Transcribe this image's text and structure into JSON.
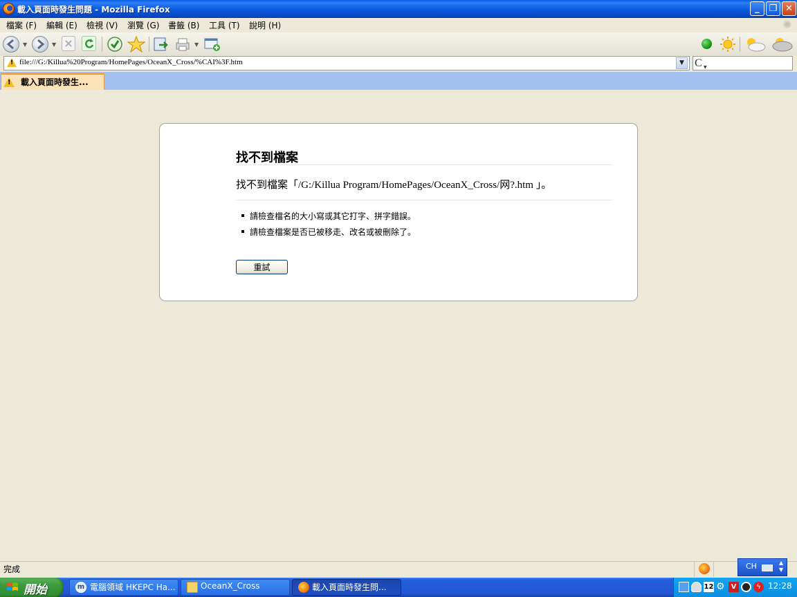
{
  "window": {
    "title": "載入頁面時發生問題 - Mozilla Firefox"
  },
  "menu": {
    "items": [
      "檔案 (F)",
      "編輯 (E)",
      "檢視 (V)",
      "瀏覽 (G)",
      "書籤 (B)",
      "工具 (T)",
      "說明 (H)"
    ]
  },
  "toolbar": {
    "icons": [
      "back-icon",
      "forward-icon",
      "stop-icon",
      "reload-icon",
      "home-icon",
      "bookmark-star-icon",
      "go-icon",
      "print-icon",
      "new-window-icon"
    ]
  },
  "address": {
    "url": "file:///G:/Killua%20Program/HomePages/OceanX_Cross/%CAI%3F.htm",
    "search_engine_icon": "C"
  },
  "tab": {
    "label": "載入頁面時發生..."
  },
  "error": {
    "title": "找不到檔案",
    "message": "找不到檔案「/G:/Killua Program/HomePages/OceanX_Cross/网?.htm 」。",
    "hints": [
      "請檢查檔名的大小寫或其它打字、拼字錯誤。",
      "請檢查檔案是否已被移走、改名或被刪除了。"
    ],
    "retry_label": "重試"
  },
  "status": {
    "text": "完成"
  },
  "language_bar": {
    "label": "CH"
  },
  "taskbar": {
    "start_label": "開始",
    "tasks": [
      {
        "label": "電腦領域 HKEPC Ha..."
      },
      {
        "label": "OceanX_Cross"
      },
      {
        "label": "載入頁面時發生問..."
      }
    ],
    "tray_badge": "12",
    "clock": "12:28"
  },
  "colors": {
    "accent": "#0a5fe8",
    "tab_active": "#fde2b8",
    "taskbar": "#245edb",
    "tray": "#0d8ee0",
    "start_green": "#3c9a3c"
  }
}
